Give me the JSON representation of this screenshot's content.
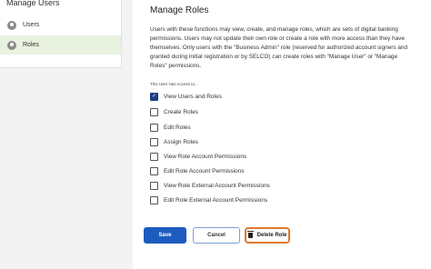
{
  "sidebar": {
    "title": "Manage Users",
    "items": [
      {
        "label": "Users",
        "icon": "user-icon"
      },
      {
        "label": "Roles",
        "icon": "user-icon",
        "active": true
      }
    ]
  },
  "main": {
    "title": "Manage Roles",
    "description": "Users with these functions may view, create, and manage roles, which are sets of digital banking permissions. Users may not update their own role or create a role with more access than they have themselves. Only users with the \"Business Admin\" role (reserved for authorized account signers and granted during initial registration or by SELCO) can create roles with \"Manage User\" or \"Manage Roles\" permissions.",
    "access_label": "This User Has Access to...",
    "permissions": [
      {
        "label": "View Users and Roles",
        "checked": true
      },
      {
        "label": "Create Roles",
        "checked": false
      },
      {
        "label": "Edit Roles",
        "checked": false
      },
      {
        "label": "Assign Roles",
        "checked": false
      },
      {
        "label": "View Role Account Permissions",
        "checked": false
      },
      {
        "label": "Edit Role Account Permissions",
        "checked": false
      },
      {
        "label": "View Role External Account Permissions",
        "checked": false
      },
      {
        "label": "Edit Role External Account Permissions",
        "checked": false
      }
    ],
    "buttons": {
      "save": "Save",
      "cancel": "Cancel",
      "delete": "Delete Role"
    }
  },
  "colors": {
    "accent": "#1d5bbf",
    "checked": "#1c3f86",
    "active_sidebar": "#e8f2df",
    "delete_outline": "#e0782b"
  }
}
